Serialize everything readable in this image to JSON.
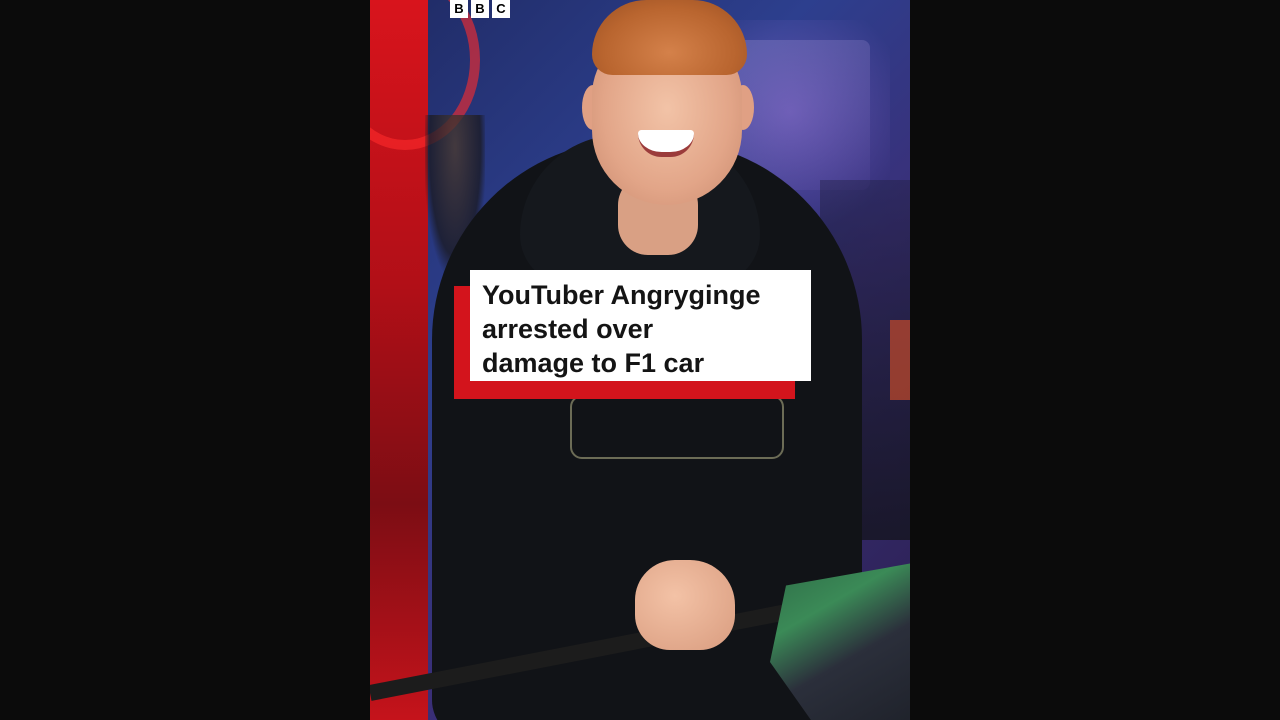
{
  "brand": {
    "logo_letters": [
      "B",
      "B",
      "C"
    ]
  },
  "story": {
    "headline_lines": [
      "YouTuber Angryginge",
      "arrested over",
      "damage to F1 car"
    ]
  },
  "colors": {
    "accent_red": "#d3141c",
    "card_bg": "#ffffff",
    "page_bg": "#0b0b0b"
  }
}
